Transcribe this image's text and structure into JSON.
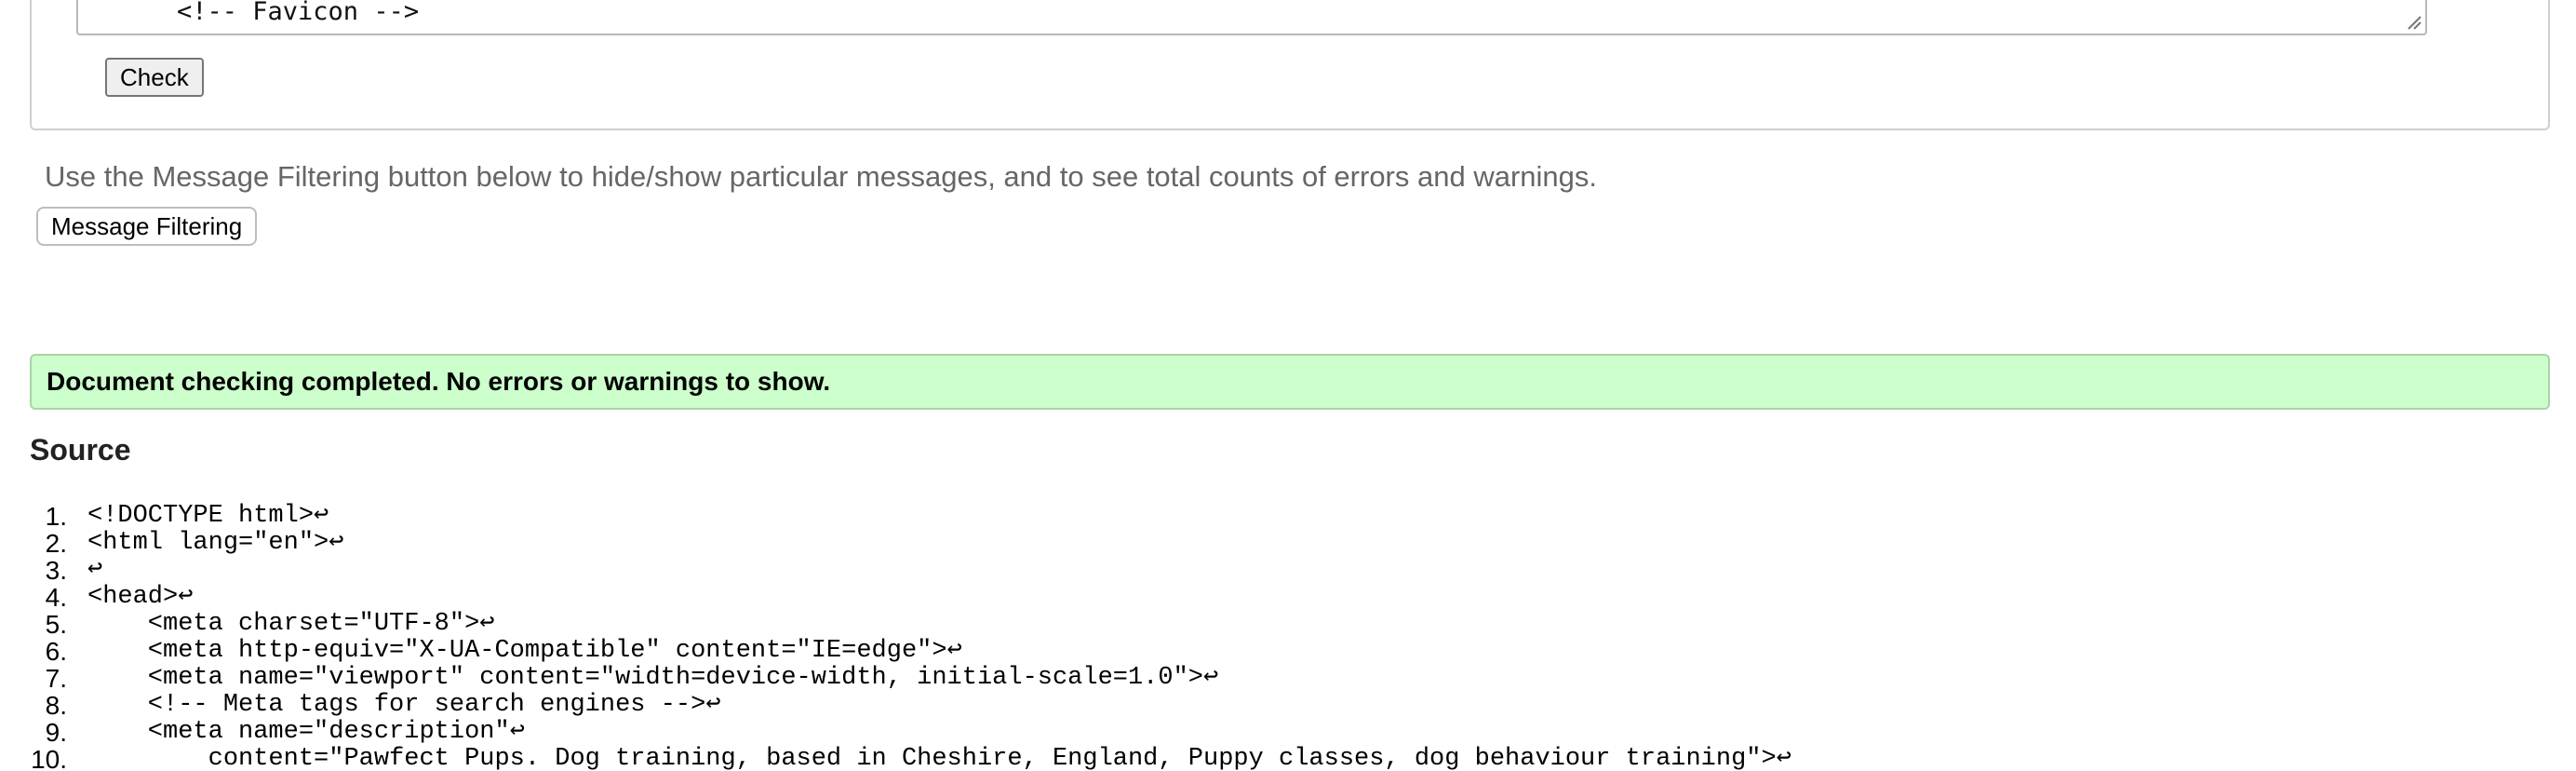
{
  "form": {
    "textarea_text": "<!-- Favicon -->",
    "check_label": "Check"
  },
  "filter": {
    "hint": "Use the Message Filtering button below to hide/show particular messages, and to see total counts of errors and warnings.",
    "button_label": "Message Filtering"
  },
  "result": {
    "message": "Document checking completed. No errors or warnings to show."
  },
  "source": {
    "heading": "Source",
    "eol_marker": "↩",
    "lines": [
      {
        "no": "1.",
        "code": "<!DOCTYPE html>"
      },
      {
        "no": "2.",
        "code": "<html lang=\"en\">"
      },
      {
        "no": "3.",
        "code": ""
      },
      {
        "no": "4.",
        "code": "<head>"
      },
      {
        "no": "5.",
        "code": "    <meta charset=\"UTF-8\">"
      },
      {
        "no": "6.",
        "code": "    <meta http-equiv=\"X-UA-Compatible\" content=\"IE=edge\">"
      },
      {
        "no": "7.",
        "code": "    <meta name=\"viewport\" content=\"width=device-width, initial-scale=1.0\">"
      },
      {
        "no": "8.",
        "code": "    <!-- Meta tags for search engines -->"
      },
      {
        "no": "9.",
        "code": "    <meta name=\"description\""
      },
      {
        "no": "10.",
        "code": "        content=\"Pawfect Pups. Dog training, based in Cheshire, England, Puppy classes, dog behaviour training\">"
      }
    ]
  }
}
